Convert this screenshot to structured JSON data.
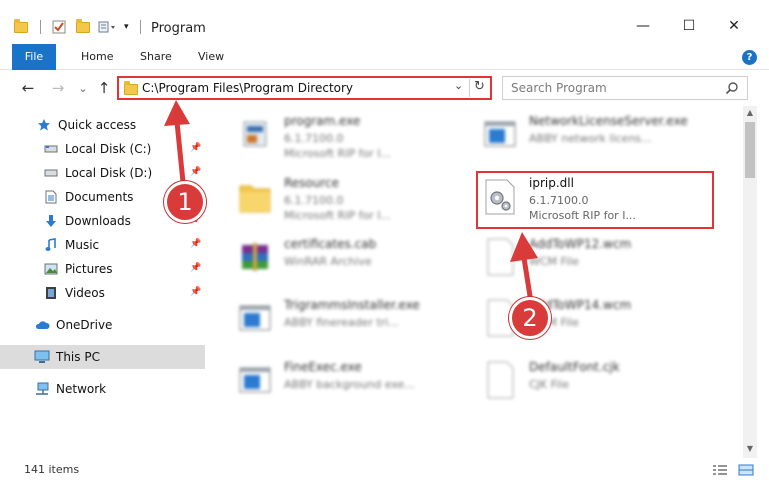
{
  "window": {
    "title": "Program",
    "minimize": "—",
    "maximize": "☐",
    "close": "✕"
  },
  "ribbon": {
    "tabs": [
      {
        "label": "File"
      },
      {
        "label": "Home"
      },
      {
        "label": "Share"
      },
      {
        "label": "View"
      }
    ],
    "help": "?"
  },
  "nav": {
    "back": "←",
    "forward": "→",
    "recent": "⌄",
    "up": "↑",
    "address": "C:\\Program Files\\Program Directory",
    "dropdown": "⌄",
    "refresh": "↻",
    "search_placeholder": "Search Program"
  },
  "sidebar": {
    "items": [
      {
        "label": "Quick access",
        "icon": "star-icon"
      },
      {
        "label": "Local Disk (C:)",
        "icon": "drive-icon"
      },
      {
        "label": "Local Disk (D:)",
        "icon": "drive-icon"
      },
      {
        "label": "Documents",
        "icon": "documents-icon"
      },
      {
        "label": "Downloads",
        "icon": "downloads-icon"
      },
      {
        "label": "Music",
        "icon": "music-icon"
      },
      {
        "label": "Pictures",
        "icon": "pictures-icon"
      },
      {
        "label": "Videos",
        "icon": "videos-icon"
      },
      {
        "label": "OneDrive",
        "icon": "cloud-icon"
      },
      {
        "label": "This PC",
        "icon": "computer-icon"
      },
      {
        "label": "Network",
        "icon": "network-icon"
      }
    ]
  },
  "files": [
    {
      "name": "program.exe",
      "line1": "6.1.7100.0",
      "line2": "Microsoft RIP for I...",
      "kind": "exe"
    },
    {
      "name": "NetworkLicenseServer.exe",
      "line1": "ABBY network licens...",
      "line2": "",
      "kind": "app"
    },
    {
      "name": "Resource",
      "line1": "6.1.7100.0",
      "line2": "Microsoft RIP for I...",
      "kind": "folder"
    },
    {
      "name": "iprip.dll",
      "line1": "6.1.7100.0",
      "line2": "Microsoft RIP for I...",
      "kind": "dll"
    },
    {
      "name": "certificates.cab",
      "line1": "WinRAR Archive",
      "line2": "",
      "kind": "archive"
    },
    {
      "name": "AddToWP12.wcm",
      "line1": "WCM File",
      "line2": "",
      "kind": "blank"
    },
    {
      "name": "TrigrammsInstaller.exe",
      "line1": "ABBY finereader tri...",
      "line2": "",
      "kind": "app"
    },
    {
      "name": "AddToWP14.wcm",
      "line1": "WCM File",
      "line2": "",
      "kind": "blank"
    },
    {
      "name": "FineExec.exe",
      "line1": "ABBY background exe...",
      "line2": "",
      "kind": "app"
    },
    {
      "name": "DefaultFont.cjk",
      "line1": "CJK File",
      "line2": "",
      "kind": "blank"
    }
  ],
  "annotations": {
    "badge1": "1",
    "badge2": "2"
  },
  "status": {
    "count": "141 items"
  },
  "colors": {
    "accent": "#1a73c9",
    "annotation_red": "#e33535"
  }
}
